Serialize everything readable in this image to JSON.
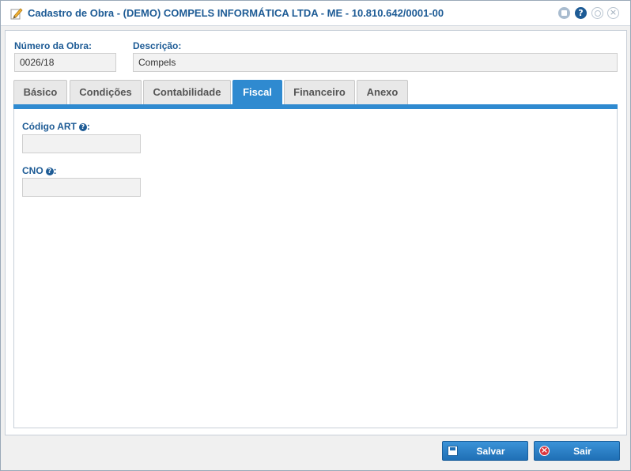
{
  "window": {
    "title": "Cadastro de Obra - (DEMO) COMPELS INFORMÁTICA LTDA - ME - 10.810.642/0001-00",
    "title_icon": "pencil-edit-icon",
    "controls": {
      "help_glyph": "?",
      "close_glyph": "×"
    }
  },
  "header_fields": {
    "numero": {
      "label": "Número da Obra:",
      "value": "0026/18"
    },
    "descricao": {
      "label": "Descrição:",
      "value": "Compels"
    }
  },
  "tabs": [
    {
      "label": "Básico",
      "active": false
    },
    {
      "label": "Condições",
      "active": false
    },
    {
      "label": "Contabilidade",
      "active": false
    },
    {
      "label": "Fiscal",
      "active": true
    },
    {
      "label": "Financeiro",
      "active": false
    },
    {
      "label": "Anexo",
      "active": false
    }
  ],
  "fiscal": {
    "codigo_art": {
      "label": "Código ART",
      "suffix": ":",
      "help_glyph": "?",
      "value": ""
    },
    "cno": {
      "label": "CNO",
      "suffix": ":",
      "help_glyph": "?",
      "value": ""
    }
  },
  "footer": {
    "save_label": "Salvar",
    "exit_label": "Sair"
  },
  "colors": {
    "accent": "#2f8ad0",
    "title_text": "#1d5b95",
    "exit_icon": "#d9363e"
  }
}
